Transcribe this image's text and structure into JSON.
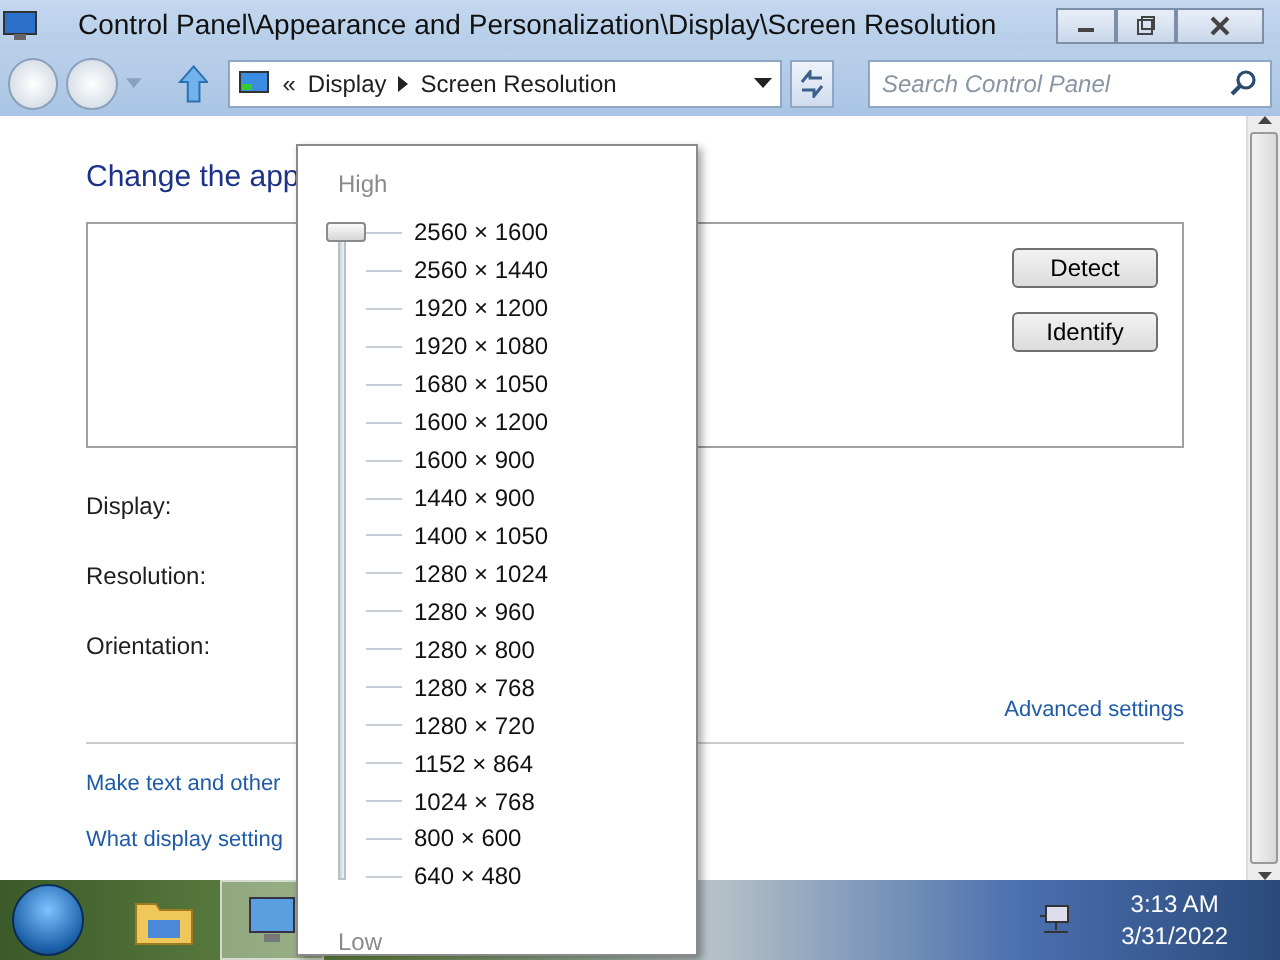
{
  "window": {
    "title": "Control Panel\\Appearance and Personalization\\Display\\Screen Resolution"
  },
  "address_bar": {
    "overflow": "«",
    "crumbs": [
      "Display",
      "Screen Resolution"
    ]
  },
  "search": {
    "placeholder": "Search Control Panel"
  },
  "heading": "Change the app",
  "buttons": [
    "Detect",
    "Identify"
  ],
  "fields": [
    "Display:",
    "Resolution:",
    "Orientation:"
  ],
  "advanced_link": "Advanced settings",
  "links": [
    "Make text and other",
    "What display setting"
  ],
  "resolution_popup": {
    "high_label": "High",
    "low_label": "Low",
    "level": 1,
    "options": [
      "2560 × 1600",
      "2560 × 1440",
      "1920 × 1200",
      "1920 × 1080",
      "1680 × 1050",
      "1600 × 1200",
      "1600 × 900",
      "1440 × 900",
      "1400 × 1050",
      "1280 × 1024",
      "1280 × 960",
      "1280 × 800",
      "1280 × 768",
      "1280 × 720",
      "1152 × 864",
      "1024 × 768",
      "800 × 600",
      "640 × 480"
    ]
  },
  "taskbar": {
    "time": "3:13 AM",
    "date": "3/31/2022"
  }
}
